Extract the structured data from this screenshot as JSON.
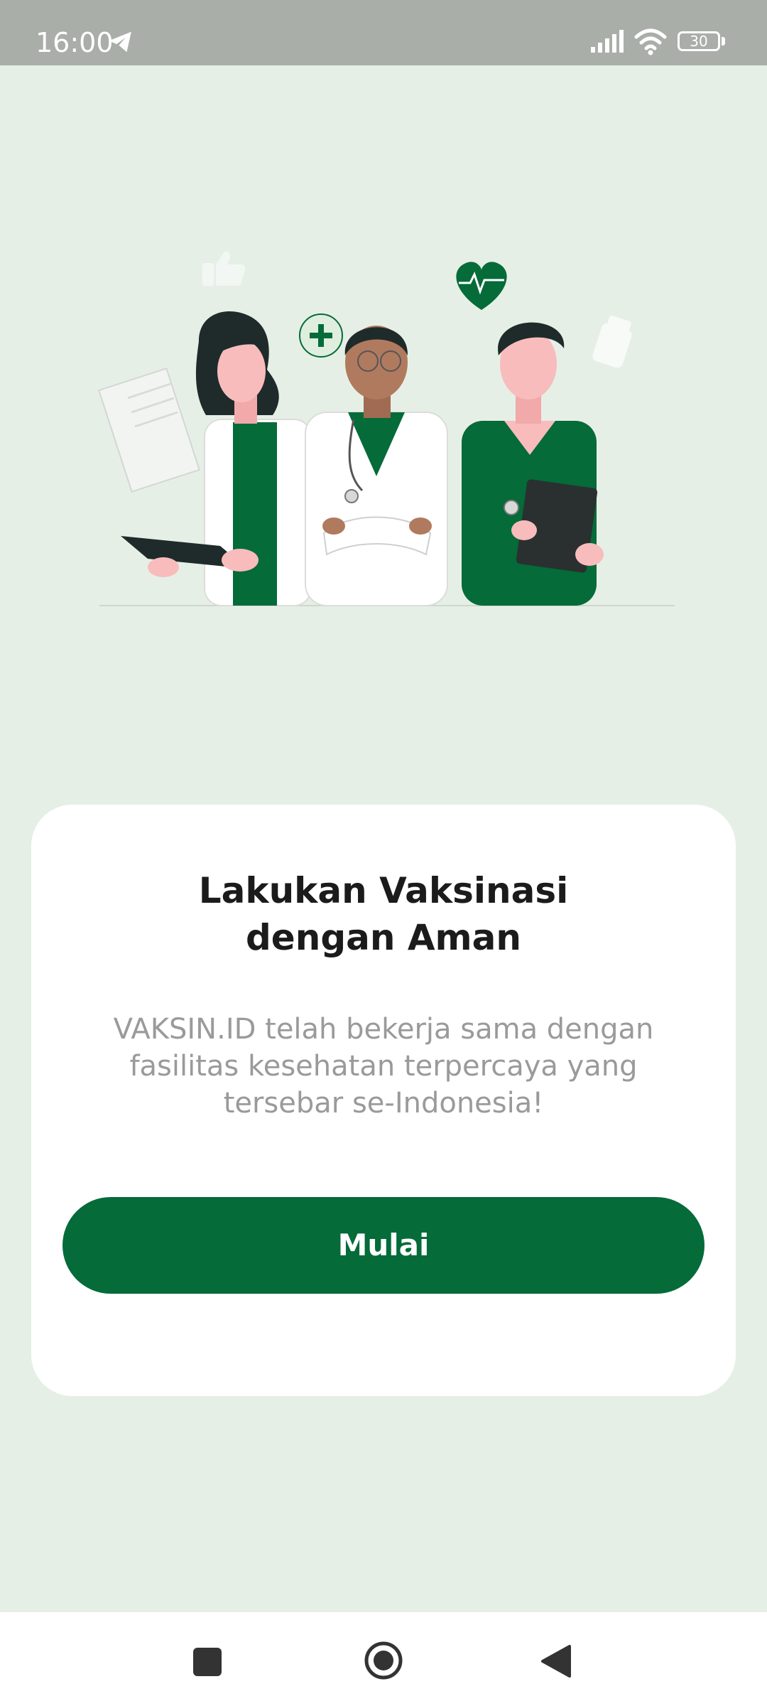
{
  "status_bar": {
    "time": "16:00",
    "battery": "30",
    "icons": [
      "telegram-icon",
      "signal-icon",
      "wifi-icon",
      "battery-icon"
    ]
  },
  "illustration": {
    "subject": "three-health-workers-illustration",
    "accent_color": "#046b39"
  },
  "card": {
    "title": "Lakukan Vaksinasi\ndengan Aman",
    "description": "VAKSIN.ID telah bekerja sama dengan fasilitas kesehatan terpercaya yang tersebar se-Indonesia!",
    "button_label": "Mulai"
  },
  "nav_bar": {
    "icons": [
      "recents-icon",
      "home-icon",
      "back-icon"
    ]
  },
  "colors": {
    "background": "#e6efe6",
    "primary": "#046b39",
    "status_bar": "#a9aea9",
    "title": "#1b1b1b",
    "description": "#9a9a9a"
  }
}
